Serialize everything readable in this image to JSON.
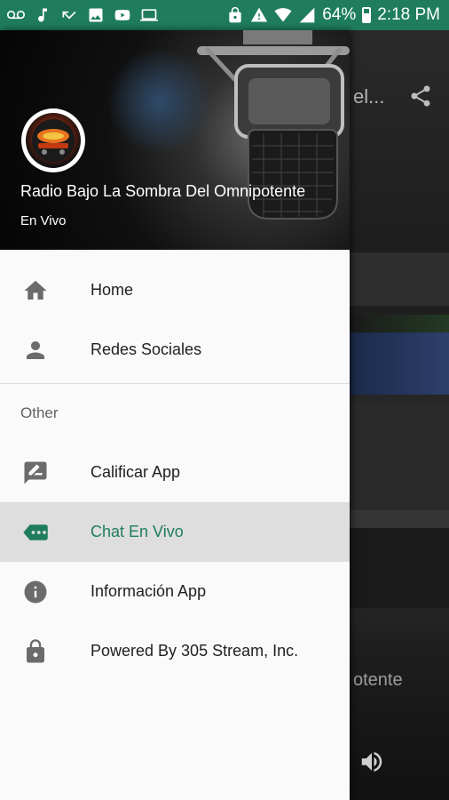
{
  "status_bar": {
    "battery": "64%",
    "time": "2:18 PM",
    "left_icons": [
      "voicemail-icon",
      "music-note-icon",
      "missed-call-icon",
      "image-icon",
      "youtube-icon",
      "cast-icon"
    ],
    "right_icons": [
      "lock-icon",
      "alert-icon",
      "wifi-icon",
      "signal-icon"
    ],
    "color": "#1f7d5e"
  },
  "drawer": {
    "station_name": "Radio Bajo La Sombra Del Omnipotente",
    "subtitle": "En Vivo",
    "items": [
      {
        "label": "Home",
        "icon": "home-icon"
      },
      {
        "label": "Redes Sociales",
        "icon": "person-icon"
      }
    ],
    "section_title": "Other",
    "other_items": [
      {
        "label": "Calificar App",
        "icon": "rate-review-icon"
      },
      {
        "label": "Chat En Vivo",
        "icon": "chat-icon",
        "active": true
      },
      {
        "label": "Información App",
        "icon": "info-icon"
      },
      {
        "label": "Powered By 305 Stream, Inc.",
        "icon": "lock-icon"
      }
    ],
    "accent": "#1f7d5e"
  },
  "background": {
    "title_partial": "el...",
    "subtitle_partial": "otente"
  }
}
